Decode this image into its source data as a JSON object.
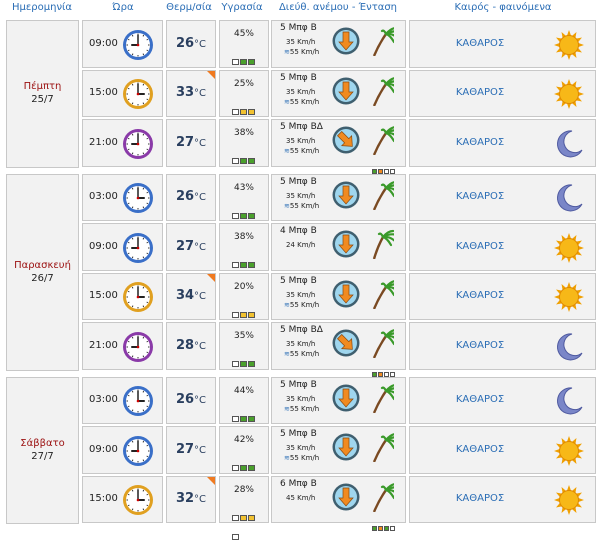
{
  "header": {
    "date": "Ημερομηνία",
    "time": "Ώρα",
    "temp": "Θερμ/σία",
    "humidity": "Υγρασία",
    "wind": "Διεύθ. ανέμου - Ένταση",
    "weather": "Καιρός - φαινόμενα"
  },
  "temp_unit": "°C",
  "colors": {
    "accent": "#2a6db5",
    "day_name": "#9b1010",
    "hot_marker": "#f07a20",
    "bar_green": "#4aa02c",
    "bar_yellow": "#f2c230",
    "bar_orange": "#f08a20"
  },
  "days": [
    {
      "name": "Πέμπτη",
      "date": "25/7",
      "rows": [
        {
          "time": "09:00",
          "clock": "09",
          "temp": "26",
          "hot": false,
          "humidity": "45%",
          "hum_level": 2,
          "hum_color": "green",
          "wind_force": "5 Μπφ Β",
          "wind_speed": "35 Km/h",
          "gust": "55 Km/h",
          "dir": "down",
          "palm_level": 3,
          "weather": "ΚΑΘΑΡΟΣ",
          "icon": "sun-icon"
        },
        {
          "time": "15:00",
          "clock": "15",
          "temp": "33",
          "hot": true,
          "humidity": "25%",
          "hum_level": 2,
          "hum_color": "yellow",
          "wind_force": "5 Μπφ Β",
          "wind_speed": "35 Km/h",
          "gust": "55 Km/h",
          "dir": "down",
          "palm_level": 3,
          "weather": "ΚΑΘΑΡΟΣ",
          "icon": "sun-icon"
        },
        {
          "time": "21:00",
          "clock": "21",
          "temp": "27",
          "hot": false,
          "humidity": "38%",
          "hum_level": 2,
          "hum_color": "green",
          "wind_force": "5 Μπφ ΒΔ",
          "wind_speed": "35 Km/h",
          "gust": "55 Km/h",
          "dir": "diag",
          "palm_level": 3,
          "weather": "ΚΑΘΑΡΟΣ",
          "icon": "moon-icon"
        }
      ]
    },
    {
      "name": "Παρασκευή",
      "date": "26/7",
      "rows": [
        {
          "time": "03:00",
          "clock": "03",
          "temp": "26",
          "hot": false,
          "humidity": "43%",
          "hum_level": 2,
          "hum_color": "green",
          "wind_force": "5 Μπφ Β",
          "wind_speed": "35 Km/h",
          "gust": "55 Km/h",
          "dir": "down",
          "palm_level": 3,
          "weather": "ΚΑΘΑΡΟΣ",
          "icon": "moon-icon"
        },
        {
          "time": "09:00",
          "clock": "09",
          "temp": "27",
          "hot": false,
          "humidity": "38%",
          "hum_level": 2,
          "hum_color": "green",
          "wind_force": "4 Μπφ Β",
          "wind_speed": "24 Km/h",
          "gust": "",
          "dir": "down",
          "palm_level": 2,
          "weather": "ΚΑΘΑΡΟΣ",
          "icon": "sun-icon"
        },
        {
          "time": "15:00",
          "clock": "15",
          "temp": "34",
          "hot": true,
          "humidity": "20%",
          "hum_level": 2,
          "hum_color": "yellow",
          "wind_force": "5 Μπφ Β",
          "wind_speed": "35 Km/h",
          "gust": "55 Km/h",
          "dir": "down",
          "palm_level": 3,
          "weather": "ΚΑΘΑΡΟΣ",
          "icon": "sun-icon"
        },
        {
          "time": "21:00",
          "clock": "21",
          "temp": "28",
          "hot": false,
          "humidity": "35%",
          "hum_level": 2,
          "hum_color": "green",
          "wind_force": "5 Μπφ ΒΔ",
          "wind_speed": "35 Km/h",
          "gust": "55 Km/h",
          "dir": "diag",
          "palm_level": 3,
          "weather": "ΚΑΘΑΡΟΣ",
          "icon": "moon-icon"
        }
      ]
    },
    {
      "name": "Σάββατο",
      "date": "27/7",
      "rows": [
        {
          "time": "03:00",
          "clock": "03",
          "temp": "26",
          "hot": false,
          "humidity": "44%",
          "hum_level": 2,
          "hum_color": "green",
          "wind_force": "5 Μπφ Β",
          "wind_speed": "35 Km/h",
          "gust": "55 Km/h",
          "dir": "down",
          "palm_level": 3,
          "weather": "ΚΑΘΑΡΟΣ",
          "icon": "moon-icon"
        },
        {
          "time": "09:00",
          "clock": "09",
          "temp": "27",
          "hot": false,
          "humidity": "42%",
          "hum_level": 2,
          "hum_color": "green",
          "wind_force": "5 Μπφ Β",
          "wind_speed": "35 Km/h",
          "gust": "55 Km/h",
          "dir": "down",
          "palm_level": 3,
          "weather": "ΚΑΘΑΡΟΣ",
          "icon": "sun-icon"
        },
        {
          "time": "15:00",
          "clock": "15",
          "temp": "32",
          "hot": true,
          "humidity": "28%",
          "hum_level": 2,
          "hum_color": "yellow",
          "wind_force": "6 Μπφ Β",
          "wind_speed": "45 Km/h",
          "gust": "",
          "dir": "down",
          "palm_level": 4,
          "weather": "ΚΑΘΑΡΟΣ",
          "icon": "sun-icon"
        }
      ]
    }
  ]
}
